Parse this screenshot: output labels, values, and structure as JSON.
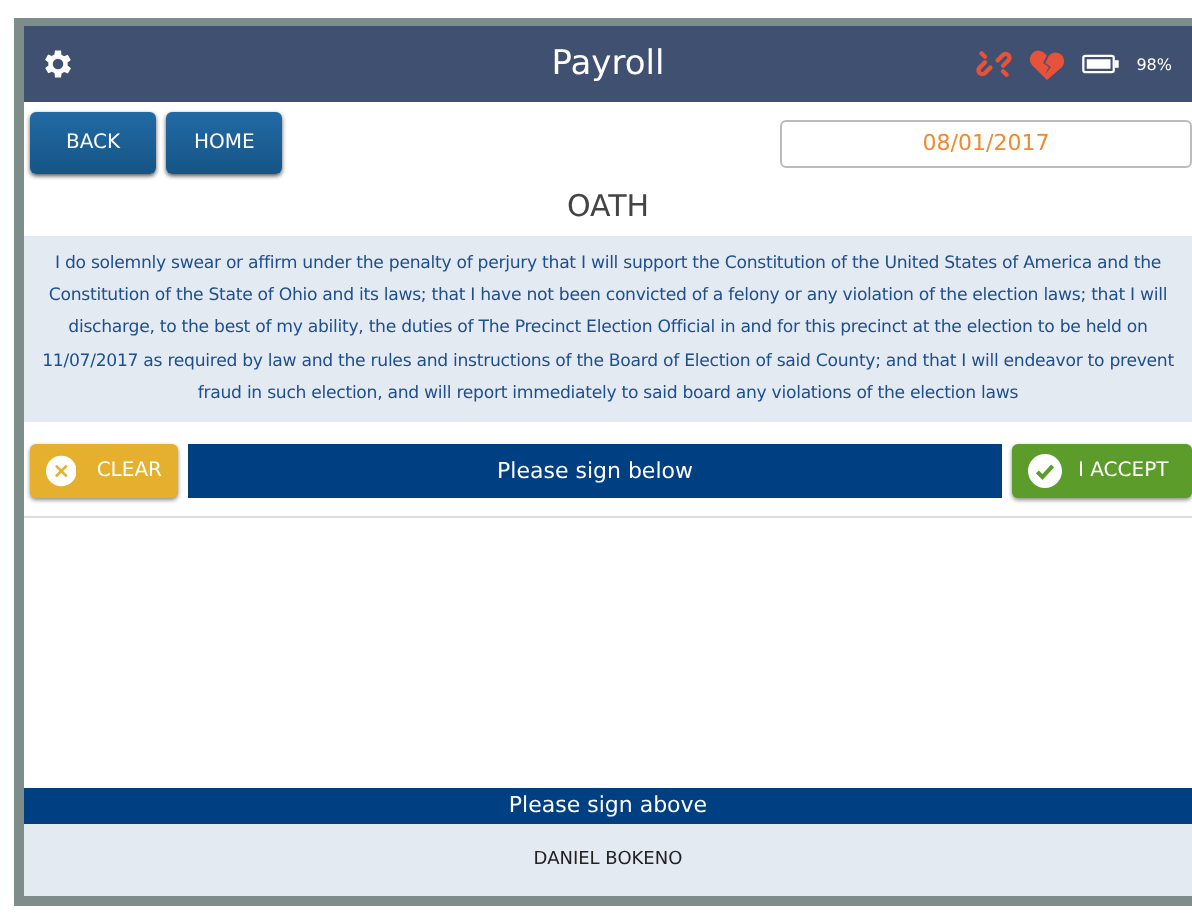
{
  "header": {
    "title": "Payroll",
    "battery": "98%"
  },
  "nav_buttons": [
    "BACK",
    "HOME"
  ],
  "date": "08/01/2017",
  "heading": "OATH",
  "oath_text": "I do solemnly swear or affirm under the penalty of perjury that I will support the Constitution of the United States of America and the Constitution of the State of Ohio and its laws; that I have not been convicted of a felony or any violation of the election laws; that I will discharge, to the best of my ability, the duties of The Precinct Election Official in and for this precinct at the election to be held on 11/07/2017 as required by law and the rules and instructions of the Board of Election of said County; and that I will endeavor to prevent fraud in such election, and will report immediately to said board any violations of the election laws",
  "clear_button": "CLEAR",
  "sign_below": "Please sign below",
  "accept_button": "I ACCEPT",
  "sign_above": "Please sign above",
  "signer_name": "DANIEL BOKENO"
}
